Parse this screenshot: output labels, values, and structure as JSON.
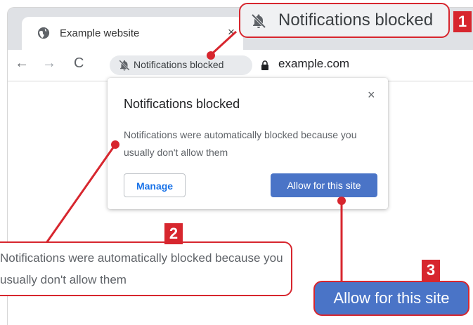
{
  "tab": {
    "title": "Example website",
    "close": "×"
  },
  "toolbar": {
    "back": "←",
    "forward": "→",
    "reload": "C",
    "chip_label": "Notifications blocked",
    "url": "example.com"
  },
  "popup": {
    "title": "Notifications blocked",
    "close": "×",
    "message": "Notifications were automatically blocked because you usually don't allow them",
    "manage_label": "Manage",
    "allow_label": "Allow for this site"
  },
  "callouts": [
    {
      "badge": "1",
      "text": "Notifications blocked"
    },
    {
      "badge": "2",
      "text": "Notifications were automatically blocked because you usually don't allow them"
    },
    {
      "badge": "3",
      "text": "Allow for this site"
    }
  ],
  "colors": {
    "accent_red": "#d7262e",
    "button_blue": "#4a74c7",
    "link_blue": "#1a73e8"
  }
}
